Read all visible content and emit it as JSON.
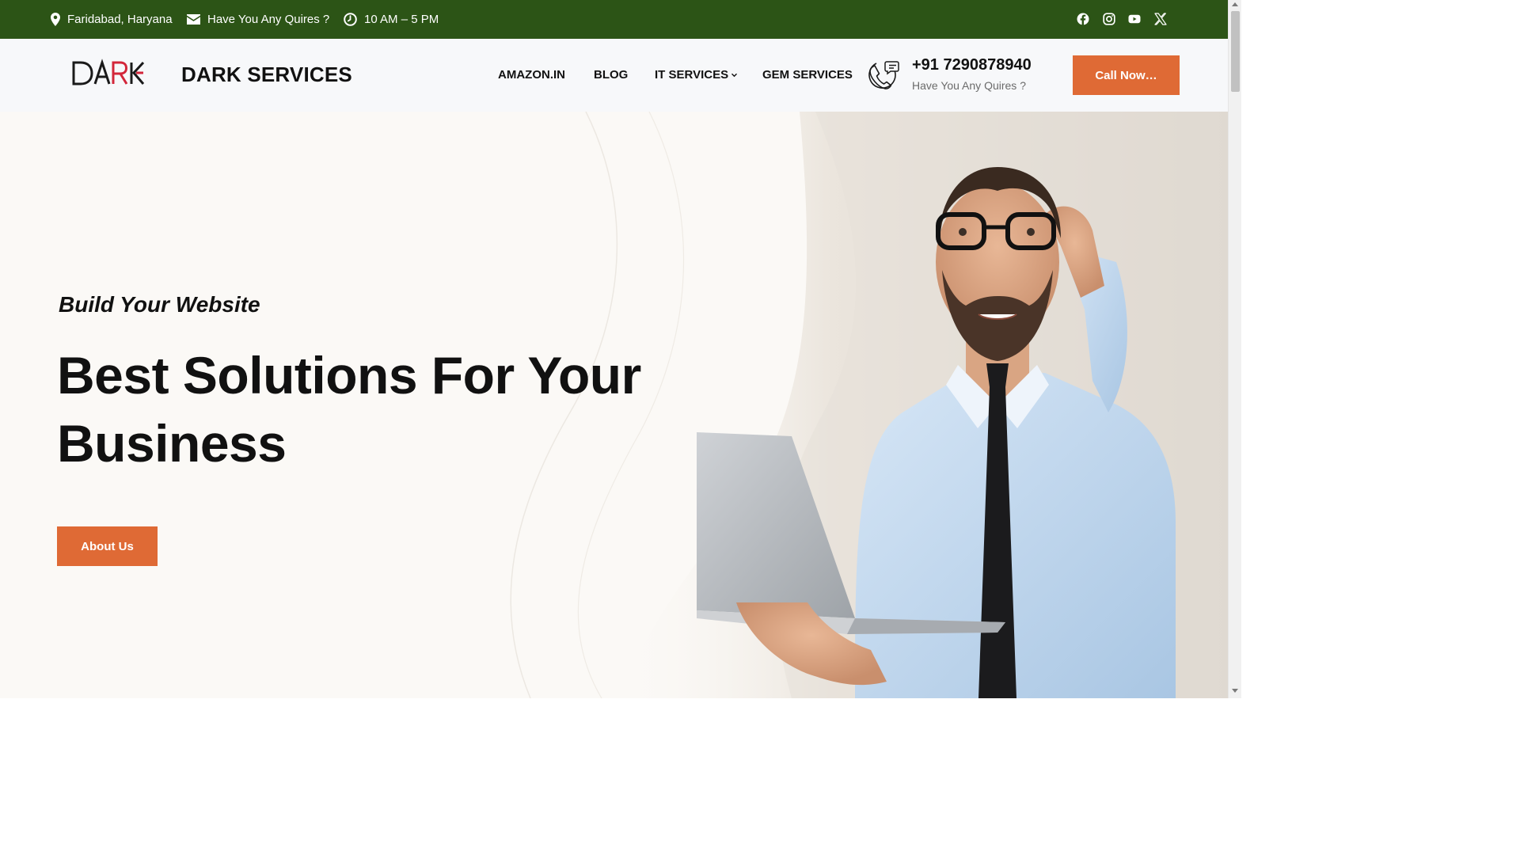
{
  "topbar": {
    "location": "Faridabad, Haryana",
    "email_text": "Have You Any Quires ?",
    "hours": "10 AM – 5 PM",
    "social_icons": [
      "facebook-icon",
      "instagram-icon",
      "youtube-icon",
      "x-icon"
    ]
  },
  "header": {
    "logo_text": "DARK",
    "site_title": "DARK SERVICES",
    "nav": [
      {
        "label": "AMAZON.IN"
      },
      {
        "label": "BLOG"
      },
      {
        "label": "IT SERVICES"
      },
      {
        "label": "GEM SERVICES"
      }
    ],
    "phone_number": "+91 7290878940",
    "phone_subtext": "Have You Any Quires ?",
    "call_button": "Call Now…"
  },
  "hero": {
    "kicker": "Build Your Website",
    "title": "Best Solutions For Your Business",
    "about_button": "About Us"
  },
  "colors": {
    "topbar_bg": "#2c5416",
    "accent": "#df6a35",
    "header_bg": "#f7f8fa",
    "hero_bg": "#fbf9f6"
  }
}
